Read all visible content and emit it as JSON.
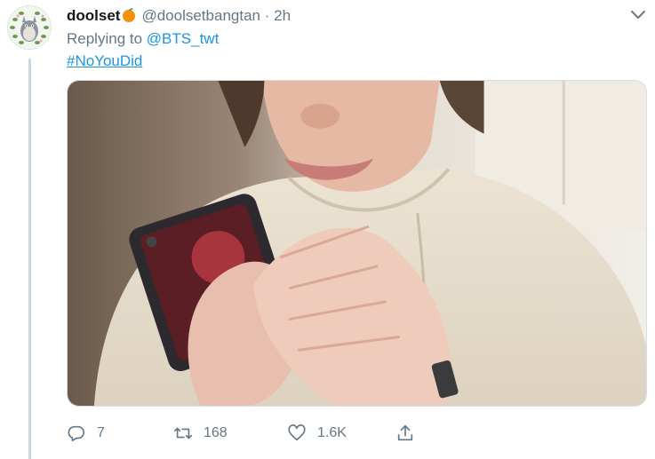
{
  "tweet": {
    "display_name": "doolset",
    "handle": "@doolsetbangtan",
    "separator": "·",
    "time": "2h",
    "replying_prefix": "Replying to",
    "replying_to": "@BTS_twt",
    "hashtag": "#NoYouDid"
  },
  "icons": {
    "avatar": "totoro-avatar",
    "name_emoji": "tangerine-emoji",
    "menu": "chevron-down-icon",
    "reply": "reply-icon",
    "retweet": "retweet-icon",
    "like": "heart-icon",
    "share": "share-icon"
  },
  "actions": {
    "replies": "7",
    "retweets": "168",
    "likes": "1.6K"
  },
  "colors": {
    "link": "#1b95e0",
    "secondary_text": "#657786",
    "thread_line": "#ccd6dd"
  }
}
